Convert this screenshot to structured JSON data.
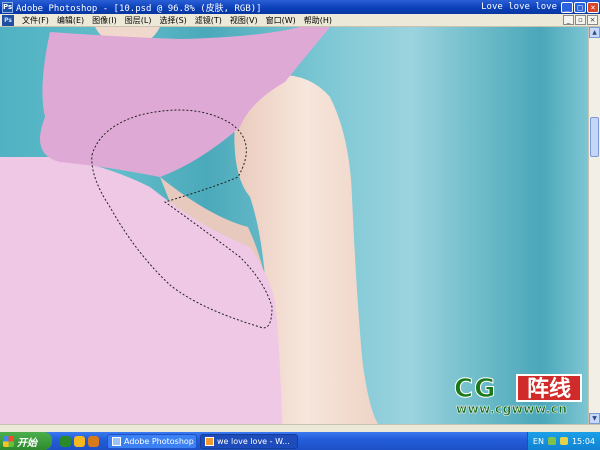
{
  "window": {
    "title": "Adobe Photoshop - [10.psd @ 96.8% (皮肤, RGB)]",
    "right_title": "Love love love"
  },
  "menu": [
    "文件(F)",
    "编辑(E)",
    "图像(I)",
    "图层(L)",
    "选择(S)",
    "滤镜(T)",
    "视图(V)",
    "窗口(W)",
    "帮助(H)"
  ],
  "watermark": {
    "cg": "CG",
    "cn": "阵线",
    "url": "www.cgwww.cn"
  },
  "taskbar": {
    "start": "开始",
    "tasks": [
      "Adobe Photoshop ...",
      "we love love - W..."
    ],
    "lang": "EN",
    "clock": "15:04"
  },
  "colors": {
    "background_teal": "#5bb6c6",
    "shirt_pink": "#eec8e4",
    "collar_pink": "#dfa9d5",
    "skin": "#f2ddd0",
    "watermark_green": "#1a7a1a",
    "watermark_red": "#d12a2a"
  }
}
